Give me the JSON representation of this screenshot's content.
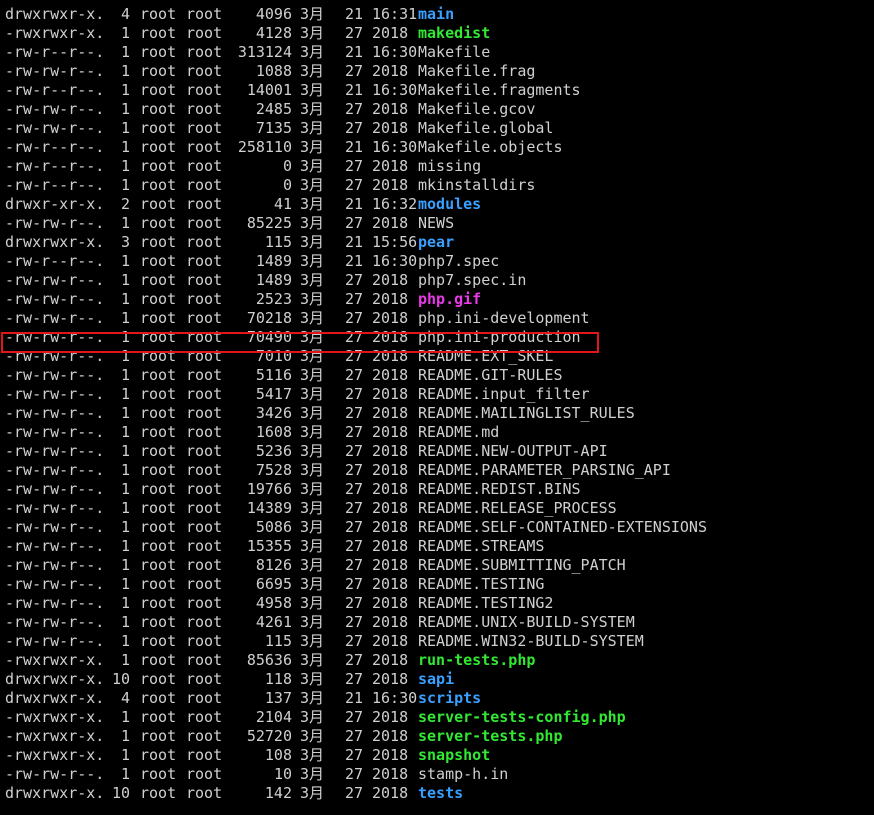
{
  "listing": {
    "rows": [
      {
        "perms": "drwxrwxr-x.",
        "links": "4",
        "owner": "root",
        "group": "root",
        "size": "4096",
        "month": "3月",
        "day": "21",
        "time": "16:31",
        "name": "main",
        "kind": "dir"
      },
      {
        "perms": "-rwxrwxr-x.",
        "links": "1",
        "owner": "root",
        "group": "root",
        "size": "4128",
        "month": "3月",
        "day": "27",
        "time": "2018",
        "name": "makedist",
        "kind": "exec"
      },
      {
        "perms": "-rw-r--r--.",
        "links": "1",
        "owner": "root",
        "group": "root",
        "size": "313124",
        "month": "3月",
        "day": "21",
        "time": "16:30",
        "name": "Makefile",
        "kind": "file"
      },
      {
        "perms": "-rw-rw-r--.",
        "links": "1",
        "owner": "root",
        "group": "root",
        "size": "1088",
        "month": "3月",
        "day": "27",
        "time": "2018",
        "name": "Makefile.frag",
        "kind": "file"
      },
      {
        "perms": "-rw-r--r--.",
        "links": "1",
        "owner": "root",
        "group": "root",
        "size": "14001",
        "month": "3月",
        "day": "21",
        "time": "16:30",
        "name": "Makefile.fragments",
        "kind": "file"
      },
      {
        "perms": "-rw-rw-r--.",
        "links": "1",
        "owner": "root",
        "group": "root",
        "size": "2485",
        "month": "3月",
        "day": "27",
        "time": "2018",
        "name": "Makefile.gcov",
        "kind": "file"
      },
      {
        "perms": "-rw-rw-r--.",
        "links": "1",
        "owner": "root",
        "group": "root",
        "size": "7135",
        "month": "3月",
        "day": "27",
        "time": "2018",
        "name": "Makefile.global",
        "kind": "file"
      },
      {
        "perms": "-rw-r--r--.",
        "links": "1",
        "owner": "root",
        "group": "root",
        "size": "258110",
        "month": "3月",
        "day": "21",
        "time": "16:30",
        "name": "Makefile.objects",
        "kind": "file"
      },
      {
        "perms": "-rw-r--r--.",
        "links": "1",
        "owner": "root",
        "group": "root",
        "size": "0",
        "month": "3月",
        "day": "27",
        "time": "2018",
        "name": "missing",
        "kind": "file"
      },
      {
        "perms": "-rw-r--r--.",
        "links": "1",
        "owner": "root",
        "group": "root",
        "size": "0",
        "month": "3月",
        "day": "27",
        "time": "2018",
        "name": "mkinstalldirs",
        "kind": "file"
      },
      {
        "perms": "drwxr-xr-x.",
        "links": "2",
        "owner": "root",
        "group": "root",
        "size": "41",
        "month": "3月",
        "day": "21",
        "time": "16:32",
        "name": "modules",
        "kind": "dir"
      },
      {
        "perms": "-rw-rw-r--.",
        "links": "1",
        "owner": "root",
        "group": "root",
        "size": "85225",
        "month": "3月",
        "day": "27",
        "time": "2018",
        "name": "NEWS",
        "kind": "file"
      },
      {
        "perms": "drwxrwxr-x.",
        "links": "3",
        "owner": "root",
        "group": "root",
        "size": "115",
        "month": "3月",
        "day": "21",
        "time": "15:56",
        "name": "pear",
        "kind": "dir"
      },
      {
        "perms": "-rw-r--r--.",
        "links": "1",
        "owner": "root",
        "group": "root",
        "size": "1489",
        "month": "3月",
        "day": "21",
        "time": "16:30",
        "name": "php7.spec",
        "kind": "file"
      },
      {
        "perms": "-rw-rw-r--.",
        "links": "1",
        "owner": "root",
        "group": "root",
        "size": "1489",
        "month": "3月",
        "day": "27",
        "time": "2018",
        "name": "php7.spec.in",
        "kind": "file"
      },
      {
        "perms": "-rw-rw-r--.",
        "links": "1",
        "owner": "root",
        "group": "root",
        "size": "2523",
        "month": "3月",
        "day": "27",
        "time": "2018",
        "name": "php.gif",
        "kind": "img"
      },
      {
        "perms": "-rw-rw-r--.",
        "links": "1",
        "owner": "root",
        "group": "root",
        "size": "70218",
        "month": "3月",
        "day": "27",
        "time": "2018",
        "name": "php.ini-development",
        "kind": "file"
      },
      {
        "perms": "-rw-rw-r--.",
        "links": "1",
        "owner": "root",
        "group": "root",
        "size": "70490",
        "month": "3月",
        "day": "27",
        "time": "2018",
        "name": "php.ini-production",
        "kind": "file"
      },
      {
        "perms": "-rw-rw-r--.",
        "links": "1",
        "owner": "root",
        "group": "root",
        "size": "7010",
        "month": "3月",
        "day": "27",
        "time": "2018",
        "name": "README.EXT_SKEL",
        "kind": "file"
      },
      {
        "perms": "-rw-rw-r--.",
        "links": "1",
        "owner": "root",
        "group": "root",
        "size": "5116",
        "month": "3月",
        "day": "27",
        "time": "2018",
        "name": "README.GIT-RULES",
        "kind": "file"
      },
      {
        "perms": "-rw-rw-r--.",
        "links": "1",
        "owner": "root",
        "group": "root",
        "size": "5417",
        "month": "3月",
        "day": "27",
        "time": "2018",
        "name": "README.input_filter",
        "kind": "file"
      },
      {
        "perms": "-rw-rw-r--.",
        "links": "1",
        "owner": "root",
        "group": "root",
        "size": "3426",
        "month": "3月",
        "day": "27",
        "time": "2018",
        "name": "README.MAILINGLIST_RULES",
        "kind": "file"
      },
      {
        "perms": "-rw-rw-r--.",
        "links": "1",
        "owner": "root",
        "group": "root",
        "size": "1608",
        "month": "3月",
        "day": "27",
        "time": "2018",
        "name": "README.md",
        "kind": "file"
      },
      {
        "perms": "-rw-rw-r--.",
        "links": "1",
        "owner": "root",
        "group": "root",
        "size": "5236",
        "month": "3月",
        "day": "27",
        "time": "2018",
        "name": "README.NEW-OUTPUT-API",
        "kind": "file"
      },
      {
        "perms": "-rw-rw-r--.",
        "links": "1",
        "owner": "root",
        "group": "root",
        "size": "7528",
        "month": "3月",
        "day": "27",
        "time": "2018",
        "name": "README.PARAMETER_PARSING_API",
        "kind": "file"
      },
      {
        "perms": "-rw-rw-r--.",
        "links": "1",
        "owner": "root",
        "group": "root",
        "size": "19766",
        "month": "3月",
        "day": "27",
        "time": "2018",
        "name": "README.REDIST.BINS",
        "kind": "file"
      },
      {
        "perms": "-rw-rw-r--.",
        "links": "1",
        "owner": "root",
        "group": "root",
        "size": "14389",
        "month": "3月",
        "day": "27",
        "time": "2018",
        "name": "README.RELEASE_PROCESS",
        "kind": "file"
      },
      {
        "perms": "-rw-rw-r--.",
        "links": "1",
        "owner": "root",
        "group": "root",
        "size": "5086",
        "month": "3月",
        "day": "27",
        "time": "2018",
        "name": "README.SELF-CONTAINED-EXTENSIONS",
        "kind": "file"
      },
      {
        "perms": "-rw-rw-r--.",
        "links": "1",
        "owner": "root",
        "group": "root",
        "size": "15355",
        "month": "3月",
        "day": "27",
        "time": "2018",
        "name": "README.STREAMS",
        "kind": "file"
      },
      {
        "perms": "-rw-rw-r--.",
        "links": "1",
        "owner": "root",
        "group": "root",
        "size": "8126",
        "month": "3月",
        "day": "27",
        "time": "2018",
        "name": "README.SUBMITTING_PATCH",
        "kind": "file"
      },
      {
        "perms": "-rw-rw-r--.",
        "links": "1",
        "owner": "root",
        "group": "root",
        "size": "6695",
        "month": "3月",
        "day": "27",
        "time": "2018",
        "name": "README.TESTING",
        "kind": "file"
      },
      {
        "perms": "-rw-rw-r--.",
        "links": "1",
        "owner": "root",
        "group": "root",
        "size": "4958",
        "month": "3月",
        "day": "27",
        "time": "2018",
        "name": "README.TESTING2",
        "kind": "file"
      },
      {
        "perms": "-rw-rw-r--.",
        "links": "1",
        "owner": "root",
        "group": "root",
        "size": "4261",
        "month": "3月",
        "day": "27",
        "time": "2018",
        "name": "README.UNIX-BUILD-SYSTEM",
        "kind": "file"
      },
      {
        "perms": "-rw-rw-r--.",
        "links": "1",
        "owner": "root",
        "group": "root",
        "size": "115",
        "month": "3月",
        "day": "27",
        "time": "2018",
        "name": "README.WIN32-BUILD-SYSTEM",
        "kind": "file"
      },
      {
        "perms": "-rwxrwxr-x.",
        "links": "1",
        "owner": "root",
        "group": "root",
        "size": "85636",
        "month": "3月",
        "day": "27",
        "time": "2018",
        "name": "run-tests.php",
        "kind": "exec"
      },
      {
        "perms": "drwxrwxr-x.",
        "links": "10",
        "owner": "root",
        "group": "root",
        "size": "118",
        "month": "3月",
        "day": "27",
        "time": "2018",
        "name": "sapi",
        "kind": "dir"
      },
      {
        "perms": "drwxrwxr-x.",
        "links": "4",
        "owner": "root",
        "group": "root",
        "size": "137",
        "month": "3月",
        "day": "21",
        "time": "16:30",
        "name": "scripts",
        "kind": "dir"
      },
      {
        "perms": "-rwxrwxr-x.",
        "links": "1",
        "owner": "root",
        "group": "root",
        "size": "2104",
        "month": "3月",
        "day": "27",
        "time": "2018",
        "name": "server-tests-config.php",
        "kind": "exec"
      },
      {
        "perms": "-rwxrwxr-x.",
        "links": "1",
        "owner": "root",
        "group": "root",
        "size": "52720",
        "month": "3月",
        "day": "27",
        "time": "2018",
        "name": "server-tests.php",
        "kind": "exec"
      },
      {
        "perms": "-rwxrwxr-x.",
        "links": "1",
        "owner": "root",
        "group": "root",
        "size": "108",
        "month": "3月",
        "day": "27",
        "time": "2018",
        "name": "snapshot",
        "kind": "exec"
      },
      {
        "perms": "-rw-rw-r--.",
        "links": "1",
        "owner": "root",
        "group": "root",
        "size": "10",
        "month": "3月",
        "day": "27",
        "time": "2018",
        "name": "stamp-h.in",
        "kind": "file"
      },
      {
        "perms": "drwxrwxr-x.",
        "links": "10",
        "owner": "root",
        "group": "root",
        "size": "142",
        "month": "3月",
        "day": "27",
        "time": "2018",
        "name": "tests",
        "kind": "dir"
      }
    ],
    "highlighted_row": 17
  },
  "colors": {
    "background": "#000000",
    "text": "#d0d0d0",
    "directory": "#3aa0ff",
    "executable": "#33e833",
    "image": "#e83ae8",
    "highlight_border": "#e0161a"
  }
}
